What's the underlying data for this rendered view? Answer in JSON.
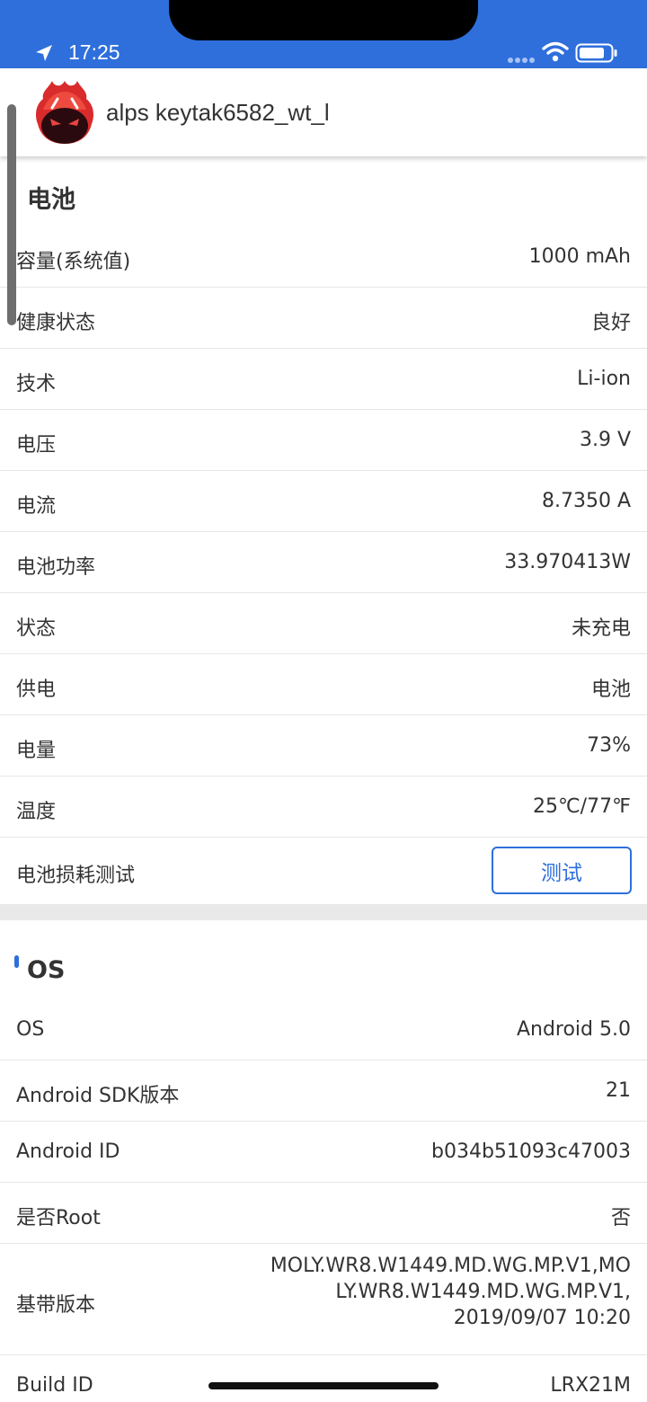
{
  "status_bar": {
    "time": "17:25",
    "color": "#2e6fdc",
    "icons": [
      "location-arrow-icon",
      "signal-dots-icon",
      "wifi-icon",
      "battery-icon"
    ]
  },
  "header": {
    "device_name": "alps keytak6582_wt_l",
    "logo_icon": "antutu-logo"
  },
  "battery": {
    "title": "电池",
    "rows": [
      {
        "label": "容量(系统值)",
        "value": "1000 mAh"
      },
      {
        "label": "健康状态",
        "value": "良好"
      },
      {
        "label": "技术",
        "value": "Li-ion"
      },
      {
        "label": "电压",
        "value": "3.9 V"
      },
      {
        "label": "电流",
        "value": "8.7350 A"
      },
      {
        "label": "电池功率",
        "value": "33.970413W"
      },
      {
        "label": "状态",
        "value": "未充电"
      },
      {
        "label": "供电",
        "value": "电池"
      },
      {
        "label": "电量",
        "value": "73%"
      },
      {
        "label": "温度",
        "value": "25℃/77℉"
      }
    ],
    "test_row": {
      "label": "电池损耗测试",
      "button": "测试"
    }
  },
  "os": {
    "title": "OS",
    "rows": [
      {
        "label": "OS",
        "value": "Android 5.0"
      },
      {
        "label": "Android SDK版本",
        "value": "21"
      },
      {
        "label": "Android ID",
        "value": "b034b51093c47003"
      },
      {
        "label": "是否Root",
        "value": "否"
      }
    ],
    "baseband": {
      "label": "基带版本",
      "lines": [
        "MOLY.WR8.W1449.MD.WG.MP.V1,MO",
        "LY.WR8.W1449.MD.WG.MP.V1,",
        "2019/09/07 10:20"
      ]
    },
    "build": {
      "label": "Build ID",
      "value": "LRX21M"
    }
  },
  "accent_color": "#2e6fdc"
}
